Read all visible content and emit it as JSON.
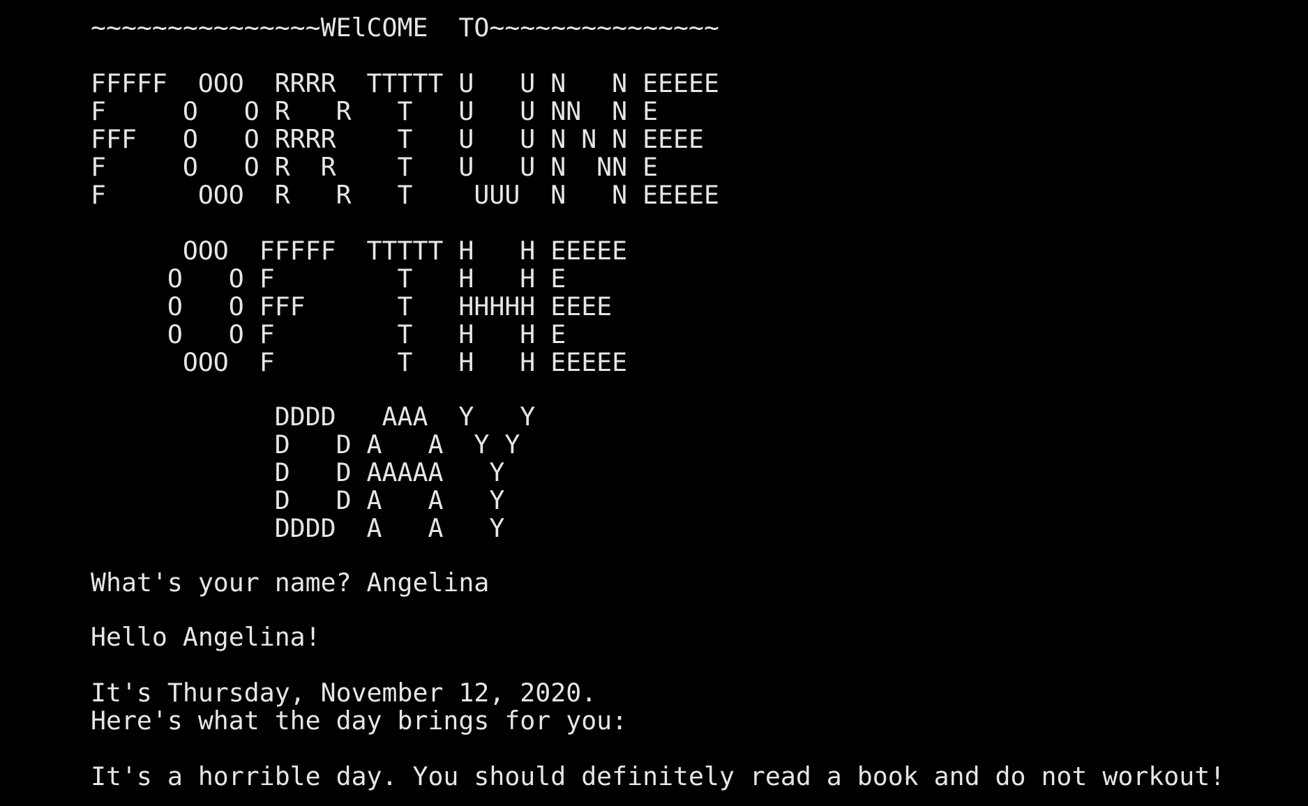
{
  "terminal": {
    "colors": {
      "background": "#000000",
      "text": "#e6e6e6"
    },
    "lines": [
      "~~~~~~~~~~~~~~~WElCOME  TO~~~~~~~~~~~~~~~",
      "",
      "FFFFF  OOO  RRRR  TTTTT U   U N   N EEEEE",
      "F     O   O R   R   T   U   U NN  N E",
      "FFF   O   O RRRR    T   U   U N N N EEEE",
      "F     O   O R  R    T   U   U N  NN E",
      "F      OOO  R   R   T    UUU  N   N EEEEE",
      "",
      "      OOO  FFFFF  TTTTT H   H EEEEE",
      "     O   O F        T   H   H E",
      "     O   O FFF      T   HHHHH EEEE",
      "     O   O F        T   H   H E",
      "      OOO  F        T   H   H EEEEE",
      "",
      "            DDDD   AAA  Y   Y",
      "            D   D A   A  Y Y",
      "            D   D AAAAA   Y",
      "            D   D A   A   Y",
      "            DDDD  A   A   Y",
      "",
      "What's your name? Angelina",
      "",
      "Hello Angelina!",
      "",
      "It's Thursday, November 12, 2020.",
      "Here's what the day brings for you:",
      "",
      "It's a horrible day. You should definitely read a book and do not workout!"
    ]
  }
}
